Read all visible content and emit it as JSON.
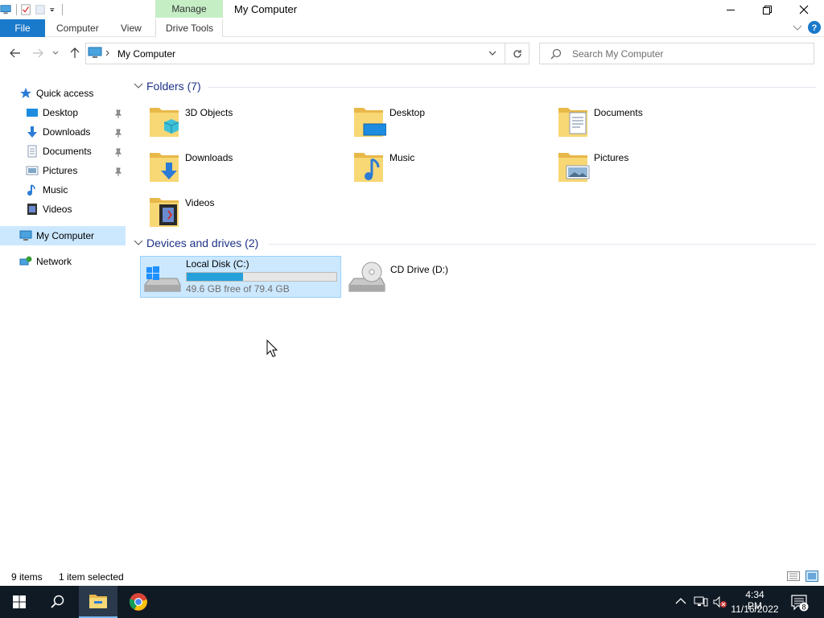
{
  "window": {
    "title": "My Computer",
    "contextual_tab": "Manage"
  },
  "ribbon": {
    "tabs": [
      {
        "label": "File"
      },
      {
        "label": "Computer"
      },
      {
        "label": "View"
      },
      {
        "label": "Drive Tools"
      }
    ]
  },
  "address": {
    "path": "My Computer",
    "search_placeholder": "Search My Computer"
  },
  "nav": {
    "quick_access": "Quick access",
    "items": [
      {
        "label": "Desktop",
        "pinned": true
      },
      {
        "label": "Downloads",
        "pinned": true
      },
      {
        "label": "Documents",
        "pinned": true
      },
      {
        "label": "Pictures",
        "pinned": true
      },
      {
        "label": "Music",
        "pinned": false
      },
      {
        "label": "Videos",
        "pinned": false
      }
    ],
    "my_computer": "My Computer",
    "network": "Network"
  },
  "content": {
    "folders_header": "Folders (7)",
    "folders": [
      {
        "label": "3D Objects",
        "icon": "3d-objects-icon"
      },
      {
        "label": "Desktop",
        "icon": "desktop-icon"
      },
      {
        "label": "Documents",
        "icon": "documents-icon"
      },
      {
        "label": "Downloads",
        "icon": "downloads-icon"
      },
      {
        "label": "Music",
        "icon": "music-icon"
      },
      {
        "label": "Pictures",
        "icon": "pictures-icon"
      },
      {
        "label": "Videos",
        "icon": "videos-icon"
      }
    ],
    "drives_header": "Devices and drives (2)",
    "drives": [
      {
        "label": "Local Disk (C:)",
        "free_text": "49.6 GB free of 79.4 GB",
        "used_fraction": 0.375,
        "selected": true
      },
      {
        "label": "CD Drive (D:)"
      }
    ]
  },
  "status": {
    "items": "9 items",
    "selected": "1 item selected"
  },
  "taskbar": {
    "time": "4:34 PM",
    "date": "11/16/2022",
    "notifications": "8"
  },
  "colors": {
    "accent": "#1979ca",
    "selection": "#cce8ff",
    "folder": "#f8d775",
    "drive_bar": "#26a0da"
  }
}
